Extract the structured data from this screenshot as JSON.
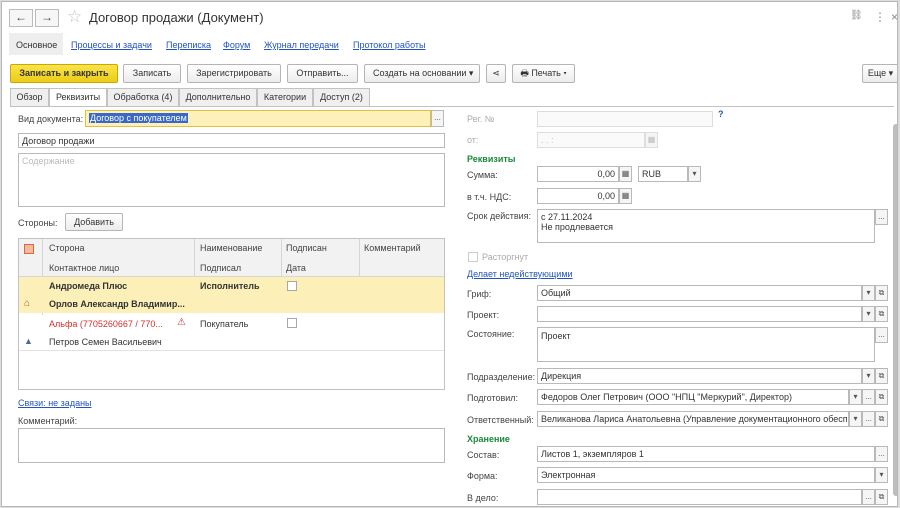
{
  "window": {
    "title": "Договор продажи (Документ)",
    "back_icon": "←",
    "fwd_icon": "→",
    "star_icon": "☆",
    "link_icon": "🔗",
    "menu_icon": "⋮",
    "close_icon": "×"
  },
  "nav": {
    "tabs": [
      "Основное",
      "Процессы и задачи",
      "Переписка",
      "Форум",
      "Журнал передачи",
      "Протокол работы"
    ]
  },
  "toolbar": {
    "save_close": "Записать и закрыть",
    "save": "Записать",
    "register": "Зарегистрировать",
    "send": "Отправить...",
    "create_based": "Создать на основании",
    "share_icon": "⋖",
    "print": "Печать",
    "more": "Еще"
  },
  "tabs": [
    "Обзор",
    "Реквизиты",
    "Обработка (4)",
    "Дополнительно",
    "Категории",
    "Доступ (2)"
  ],
  "left": {
    "doc_type_label": "Вид документа:",
    "doc_type_value": "Договор с покупателем",
    "title_value": "Договор продажи",
    "content_placeholder": "Содержание",
    "parties_label": "Стороны:",
    "add_button": "Добавить",
    "table_headers": {
      "party": "Сторона",
      "name": "Наименование",
      "signed": "Подписан",
      "comment": "Комментарий",
      "contact": "Контактное лицо",
      "signer": "Подписал",
      "date": "Дата"
    },
    "rows": [
      {
        "party": "Андромеда Плюс",
        "role": "Исполнитель",
        "contact": "Орлов Александр Владимир..."
      },
      {
        "party": "Альфа (7705260667 / 770...",
        "role": "Покупатель",
        "contact": "Петров Семен Васильевич"
      }
    ],
    "links_label": "Связи: не заданы",
    "comment_label": "Комментарий:"
  },
  "right": {
    "reg_label": "Рег. №",
    "from_label": "от:",
    "date_placeholder": ". . :",
    "help": "?",
    "requisites_header": "Реквизиты",
    "sum_label": "Сумма:",
    "sum_value": "0,00",
    "currency": "RUB",
    "vat_label": "в т.ч. НДС:",
    "vat_value": "0,00",
    "term_label": "Срок действия:",
    "term_line1": "с 27.11.2024",
    "term_line2": "Не продлевается",
    "terminated_label": "Расторгнут",
    "invalidate_link": "Делает недействующими",
    "grif_label": "Гриф:",
    "grif_value": "Общий",
    "project_label": "Проект:",
    "state_label": "Состояние:",
    "state_value": "Проект",
    "dept_label": "Подразделение:",
    "dept_value": "Дирекция",
    "prepared_label": "Подготовил:",
    "prepared_value": "Федоров Олег Петрович (ООО \"НПЦ \"Меркурий\", Директор)",
    "responsible_label": "Ответственный:",
    "responsible_value": "Великанова Лариса Анатольевна (Управление документационного обеспе",
    "storage_header": "Хранение",
    "composition_label": "Состав:",
    "composition_value": "Листов 1, экземпляров 1",
    "form_label": "Форма:",
    "form_value": "Электронная",
    "file_label": "В дело:"
  },
  "colors": {
    "accent": "#1a8a3a",
    "link": "#2255bb",
    "primary_button": "#f5d71e",
    "selected_row": "#fdefb8"
  }
}
